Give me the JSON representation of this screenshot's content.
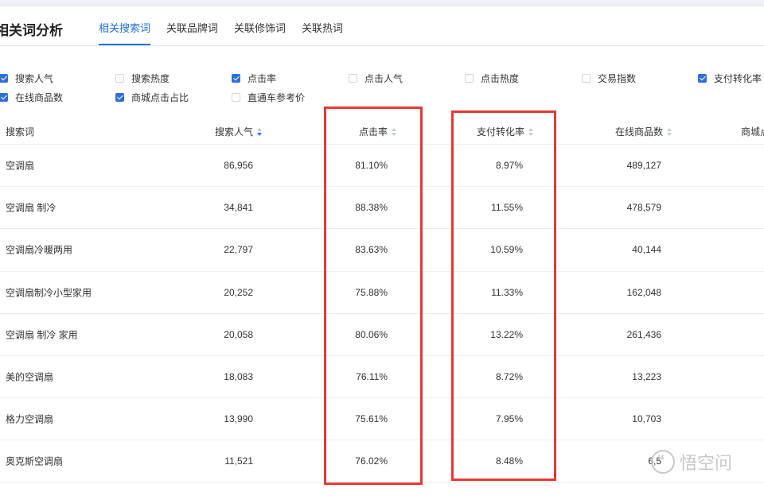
{
  "page": {
    "title": "相关词分析"
  },
  "tabs": [
    {
      "label": "相关搜索词",
      "active": true
    },
    {
      "label": "关联品牌词",
      "active": false
    },
    {
      "label": "关联修饰词",
      "active": false
    },
    {
      "label": "关联热词",
      "active": false
    }
  ],
  "filters": [
    {
      "label": "搜索人气",
      "checked": true
    },
    {
      "label": "搜索热度",
      "checked": false
    },
    {
      "label": "点击率",
      "checked": true
    },
    {
      "label": "点击人气",
      "checked": false
    },
    {
      "label": "点击热度",
      "checked": false
    },
    {
      "label": "交易指数",
      "checked": false
    },
    {
      "label": "支付转化率",
      "checked": true
    },
    {
      "label": "在线商品数",
      "checked": true
    },
    {
      "label": "商城点击占比",
      "checked": true
    },
    {
      "label": "直通车参考价",
      "checked": false
    }
  ],
  "table": {
    "headers": [
      "搜索词",
      "搜索人气",
      "点击率",
      "支付转化率",
      "在线商品数",
      "商城点"
    ],
    "rows": [
      [
        "空调扇",
        "86,956",
        "81.10%",
        "8.97%",
        "489,127"
      ],
      [
        "空调扇 制冷",
        "34,841",
        "88.38%",
        "11.55%",
        "478,579"
      ],
      [
        "空调扇冷暖两用",
        "22,797",
        "83.63%",
        "10.59%",
        "40,144"
      ],
      [
        "空调扇制冷小型家用",
        "20,252",
        "75.88%",
        "11.33%",
        "162,048"
      ],
      [
        "空调扇 制冷 家用",
        "20,058",
        "80.06%",
        "13.22%",
        "261,436"
      ],
      [
        "美的空调扇",
        "18,083",
        "76.11%",
        "8.72%",
        "13,223"
      ],
      [
        "格力空调扇",
        "13,990",
        "75.61%",
        "7.95%",
        "10,703"
      ],
      [
        "奥克斯空调扇",
        "11,521",
        "76.02%",
        "8.48%",
        "6,5"
      ]
    ]
  },
  "watermark": {
    "text": "悟空问"
  },
  "colors": {
    "accent": "#1f6ed4",
    "highlight": "#e53935"
  }
}
